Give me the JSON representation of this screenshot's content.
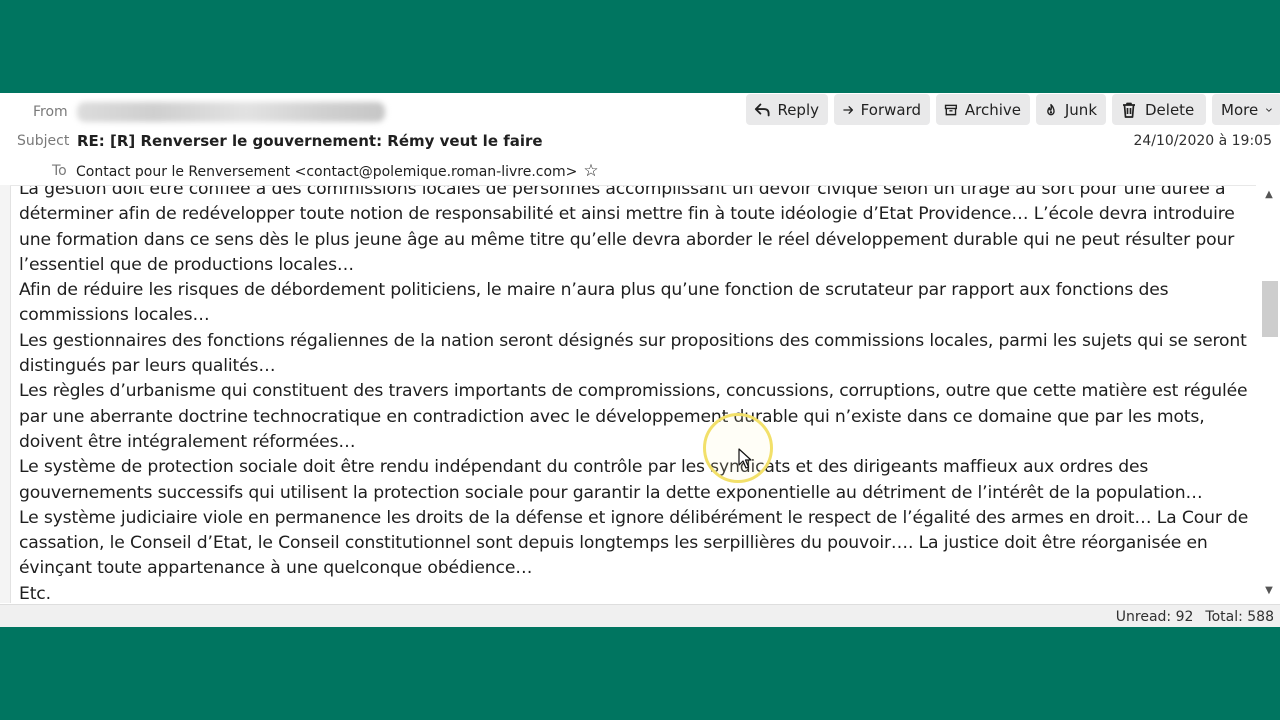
{
  "header": {
    "from_label": "From",
    "subject_label": "Subject",
    "subject": "RE: [R] Renverser le gouvernement: Rémy veut le faire",
    "to_label": "To",
    "to": "Contact pour le Renversement <contact@polemique.roman-livre.com>",
    "date": "24/10/2020 à 19:05"
  },
  "toolbar": {
    "reply": "Reply",
    "forward": "Forward",
    "archive": "Archive",
    "junk": "Junk",
    "delete": "Delete",
    "more": "More"
  },
  "body": {
    "paragraphs": [
      "La gestion doit être confiée à des commissions locales de personnes accomplissant un devoir civique selon un tirage au sort pour une durée à déterminer afin de redévelopper toute notion de responsabilité et ainsi mettre fin à toute idéologie d’Etat Providence… L’école devra introduire une formation dans ce sens dès le plus jeune âge au même titre qu’elle devra aborder le réel développement durable qui ne peut résulter pour l’essentiel que de productions locales…",
      "Afin de réduire les risques de débordement politiciens, le maire n’aura plus qu’une fonction de scrutateur par rapport aux fonctions des commissions locales…",
      "Les gestionnaires des fonctions régaliennes de la nation seront désignés sur propositions des commissions locales, parmi les sujets qui se seront distingués par leurs qualités…",
      "Les règles d’urbanisme qui constituent des travers importants de compromissions, concussions, corruptions, outre que cette matière est régulée par une aberrante doctrine technocratique en contradiction avec le développement durable qui n’existe dans ce domaine que par les mots, doivent être intégralement réformées…",
      "Le système de protection sociale doit être rendu indépendant du contrôle par les syndicats et des dirigeants maffieux aux ordres des gouvernements successifs qui utilisent la protection sociale pour garantir la dette exponentielle au détriment de l’intérêt de la population…",
      "Le système judiciaire viole en permanence les droits de la défense et ignore délibérément le respect de l’égalité des armes en droit… La Cour de cassation, le Conseil d’Etat, le Conseil constitutionnel sont depuis longtemps les serpillières du pouvoir…. La justice doit être réorganisée en évinçant toute appartenance à une quelconque obédience…",
      "Etc."
    ]
  },
  "status": {
    "unread": "Unread: 92",
    "total": "Total: 588"
  },
  "colors": {
    "background": "#007560",
    "toolbar_button": "#e9e9ea"
  }
}
